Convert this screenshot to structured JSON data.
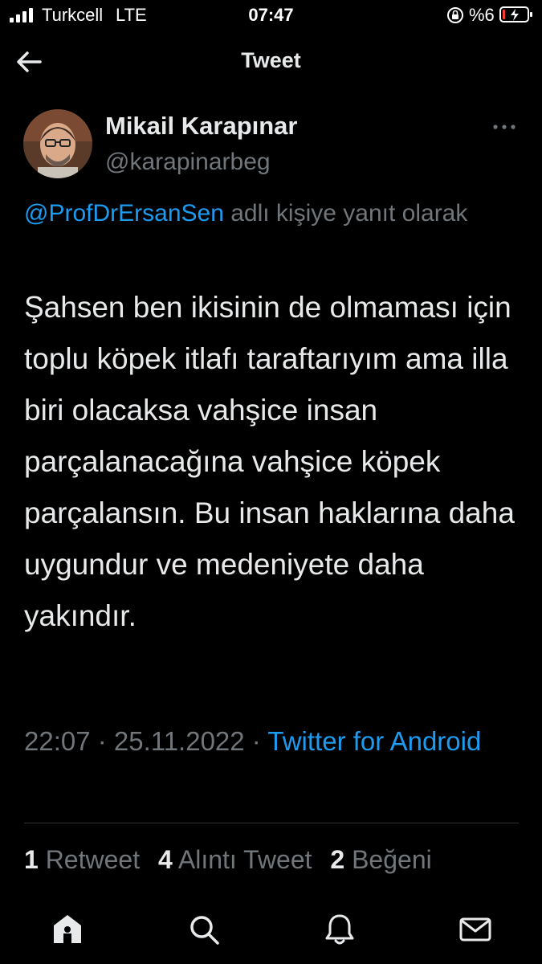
{
  "status_bar": {
    "carrier": "Turkcell",
    "network": "LTE",
    "time": "07:47",
    "battery": "%6",
    "icons": [
      "signal-icon",
      "rotation-lock-icon",
      "battery-icon"
    ]
  },
  "header": {
    "title": "Tweet",
    "back_icon": "back-arrow-icon"
  },
  "tweet": {
    "author_name": "Mikail Karapınar",
    "author_handle": "@karapinarbeg",
    "reply_mention": "@ProfDrErsanSen",
    "reply_suffix": " adlı kişiye yanıt olarak",
    "text": "Şahsen ben ikisinin de olmaması için toplu köpek itlafı taraftarıyım ama illa biri olacaksa vahşice insan parçalanacağına vahşice köpek parçalansın. Bu insan haklarına daha uygundur ve medeniyete daha yakındır.",
    "time": "22:07",
    "date": "25.11.2022",
    "separator": " · ",
    "source": "Twitter for Android"
  },
  "stats": {
    "retweets_count": "1",
    "retweets_label": "Retweet",
    "quotes_count": "4",
    "quotes_label": "Alıntı Tweet",
    "likes_count": "2",
    "likes_label": "Beğeni"
  },
  "bottom_nav": {
    "items": [
      "home-icon",
      "search-icon",
      "notifications-icon",
      "messages-icon"
    ]
  },
  "colors": {
    "background": "#000000",
    "text": "#e7e9ea",
    "secondary": "#71767b",
    "accent": "#1d9bf0",
    "divider": "#2f3336"
  }
}
